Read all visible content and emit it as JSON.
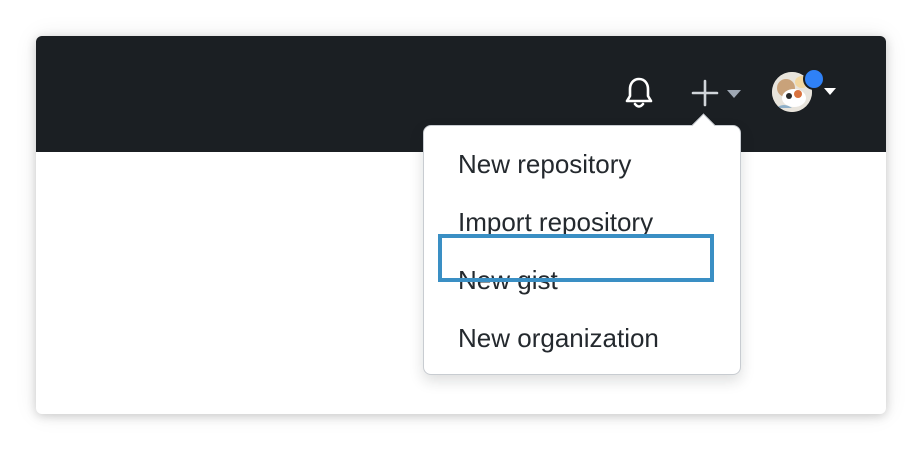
{
  "header": {
    "background_color": "#1b1f23",
    "icons": {
      "notifications": "bell-icon",
      "create": "plus-icon",
      "create_caret": "caret-down-icon",
      "profile": "avatar",
      "profile_caret": "caret-down-icon"
    },
    "notification_dot_color": "#2f81f7"
  },
  "create_menu": {
    "items": [
      {
        "label": "New repository"
      },
      {
        "label": "Import repository"
      },
      {
        "label": "New gist"
      },
      {
        "label": "New organization"
      }
    ],
    "highlighted_index": 1,
    "highlight_color": "#3a8fc4"
  }
}
